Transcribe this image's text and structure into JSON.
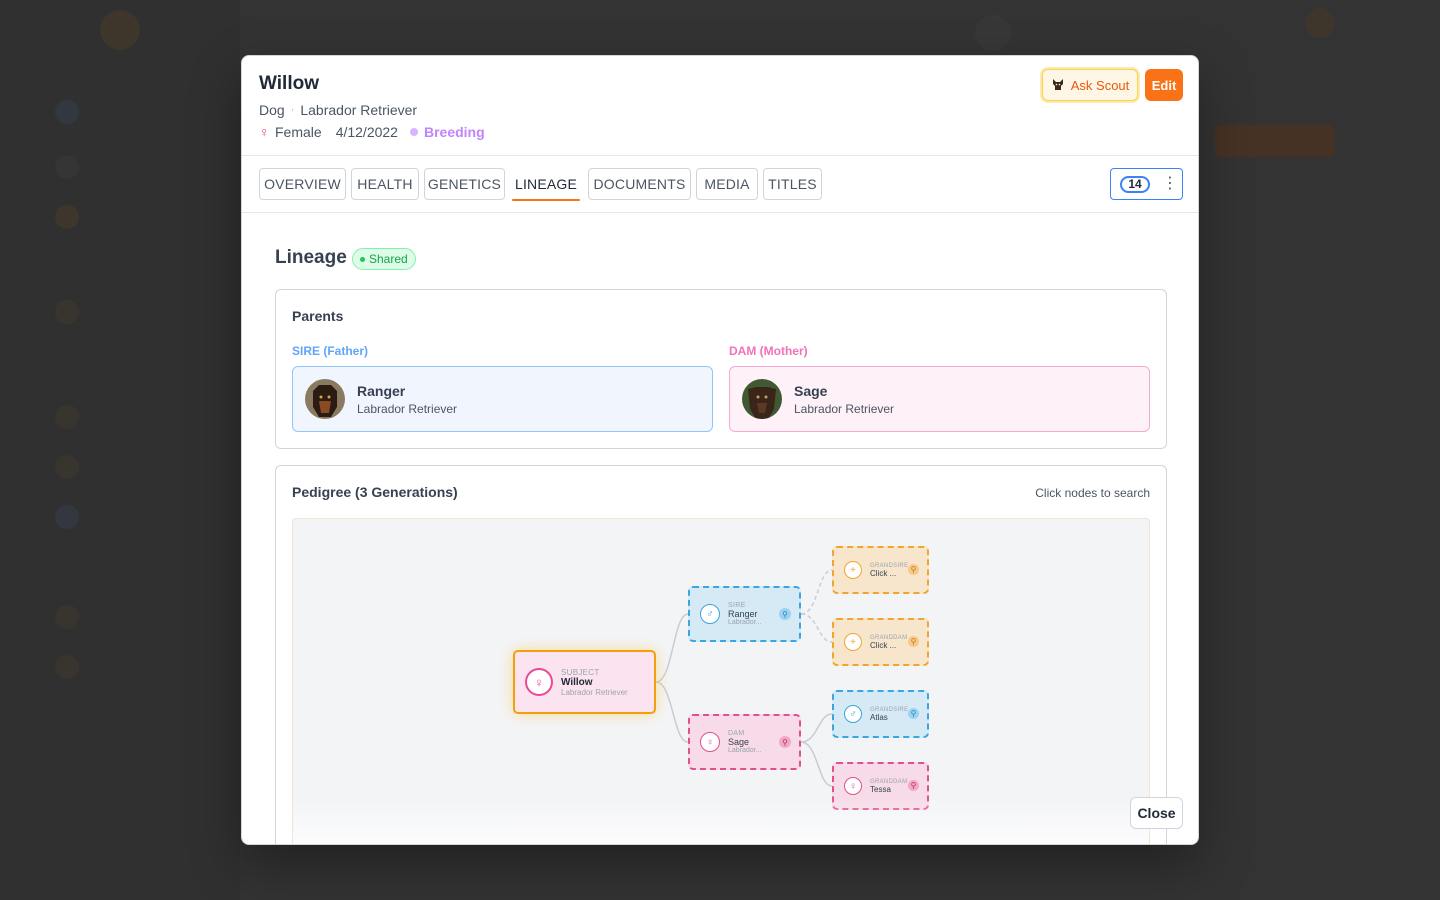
{
  "pet": {
    "name": "Willow",
    "species": "Dog",
    "breed": "Labrador Retriever",
    "gender_symbol": "♀",
    "gender": "Female",
    "birth_date": "4/12/2022",
    "status": "Breeding"
  },
  "header": {
    "ask_label": "Ask Scout",
    "edit_label": "Edit"
  },
  "tabs": [
    "OVERVIEW",
    "HEALTH",
    "GENETICS",
    "LINEAGE",
    "DOCUMENTS",
    "MEDIA",
    "TITLES"
  ],
  "active_tab": "LINEAGE",
  "count": "14",
  "lineage": {
    "title": "Lineage",
    "badge": "Shared",
    "parents": {
      "title": "Parents",
      "sire_label": "SIRE (Father)",
      "dam_label": "DAM (Mother)",
      "sire": {
        "name": "Ranger",
        "breed": "Labrador Retriever"
      },
      "dam": {
        "name": "Sage",
        "breed": "Labrador Retriever"
      }
    },
    "pedigree": {
      "title": "Pedigree (3 Generations)",
      "hint": "Click nodes to search",
      "subject": {
        "label": "SUBJECT",
        "name": "Willow",
        "breed": "Labrador Retriever"
      },
      "sire": {
        "label": "SIRE",
        "name": "Ranger",
        "breed": "Labrador..."
      },
      "dam": {
        "label": "DAM",
        "name": "Sage",
        "breed": "Labrador..."
      },
      "grandparents": [
        {
          "label": "GRANDSIRE",
          "name": "Click ..."
        },
        {
          "label": "GRANDDAM",
          "name": "Click ..."
        },
        {
          "label": "GRANDSIRE",
          "name": "Atlas"
        },
        {
          "label": "GRANDDAM",
          "name": "Tessa"
        }
      ]
    }
  },
  "footer": {
    "close_label": "Close"
  },
  "colors": {
    "accent": "#f97316",
    "sire": "#3ba5dd",
    "dam": "#e0508e",
    "unknown": "#f1a531",
    "shared": "#16a34a",
    "breeding": "#c084fc"
  }
}
